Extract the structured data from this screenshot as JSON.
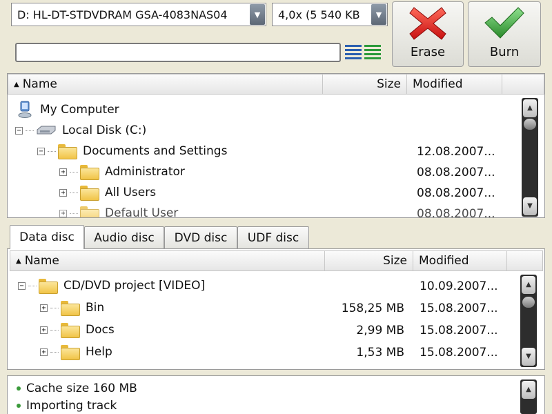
{
  "toolbar": {
    "drive_value": "D: HL-DT-STDVDRAM GSA-4083NAS04",
    "speed_value": "4,0x (5 540 KB",
    "erase_label": "Erase",
    "burn_label": "Burn",
    "colors": {
      "erase": "#e02020",
      "burn": "#3aa63a"
    }
  },
  "explorer": {
    "columns": {
      "name": "Name",
      "size": "Size",
      "modified": "Modified"
    },
    "rows": [
      {
        "name": "My Computer",
        "modified": ""
      },
      {
        "name": "Local Disk (C:)",
        "modified": ""
      },
      {
        "name": "Documents and Settings",
        "modified": "12.08.2007..."
      },
      {
        "name": "Administrator",
        "modified": "08.08.2007..."
      },
      {
        "name": "All Users",
        "modified": "08.08.2007..."
      },
      {
        "name": "Default User",
        "modified": "08.08.2007..."
      }
    ]
  },
  "tabs": [
    "Data disc",
    "Audio disc",
    "DVD disc",
    "UDF disc"
  ],
  "project": {
    "columns": {
      "name": "Name",
      "size": "Size",
      "modified": "Modified"
    },
    "rows": [
      {
        "name": "CD/DVD project [VIDEO]",
        "size": "",
        "modified": "10.09.2007..."
      },
      {
        "name": "Bin",
        "size": "158,25 MB",
        "modified": "15.08.2007..."
      },
      {
        "name": "Docs",
        "size": "2,99 MB",
        "modified": "15.08.2007..."
      },
      {
        "name": "Help",
        "size": "1,53 MB",
        "modified": "15.08.2007..."
      }
    ]
  },
  "log": {
    "lines": [
      "Cache size 160 MB",
      "Importing track"
    ]
  }
}
